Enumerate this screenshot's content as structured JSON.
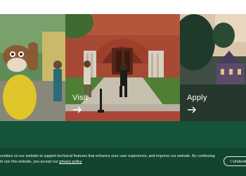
{
  "tiles": [
    {
      "title": "",
      "arrow_icon": "arrow-right-icon"
    },
    {
      "title": "Visit",
      "arrow_icon": "arrow-right-icon"
    },
    {
      "title": "Apply",
      "arrow_icon": "arrow-right-icon"
    }
  ],
  "cookie_banner": {
    "text_before_link": "cookies on our website to support technical features that enhance your user experience, and improve our website. By continuing to use this website, you accept our ",
    "link_text": "privacy policy",
    "button_label": "I Underst"
  },
  "colors": {
    "brand_green": "#14553a",
    "cookie_band": "#11452f",
    "text_white": "#ffffff"
  }
}
